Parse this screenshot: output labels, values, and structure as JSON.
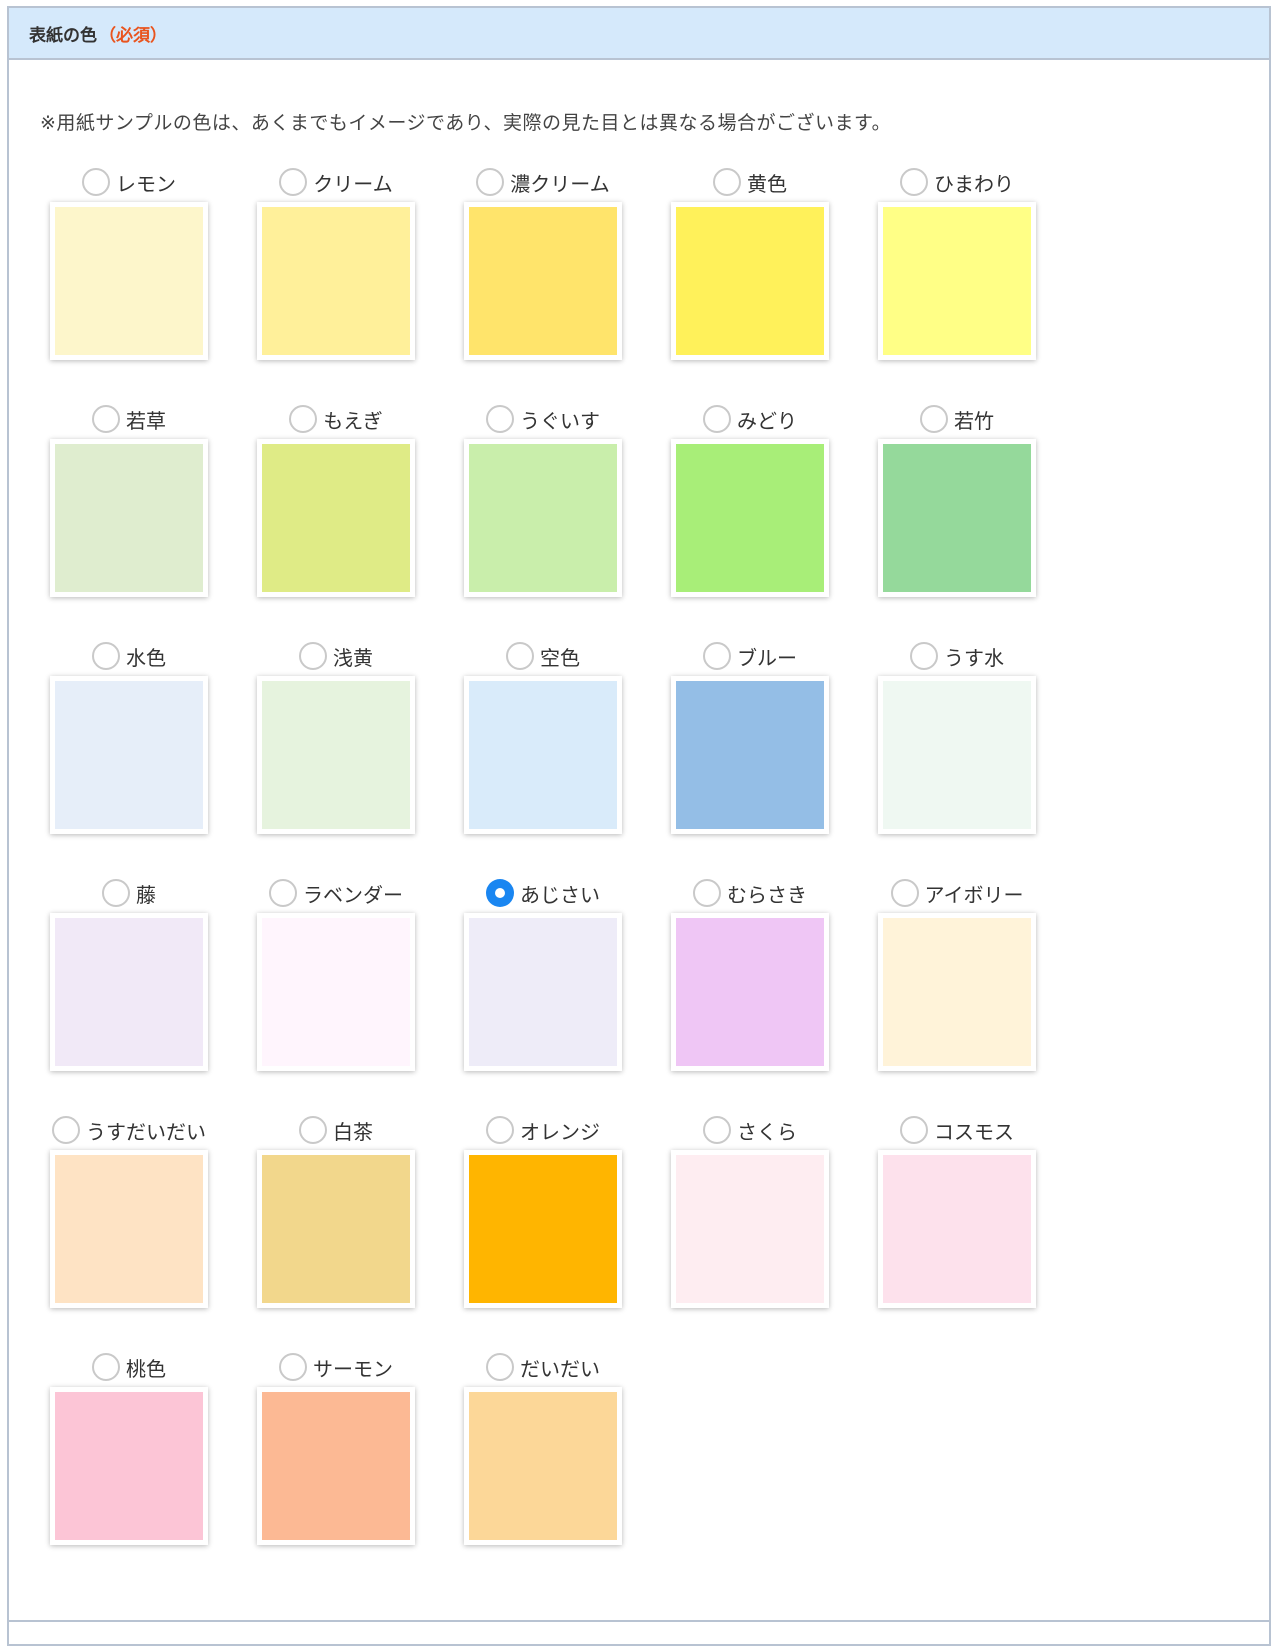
{
  "section": {
    "title": "表紙の色",
    "required": "（必須）",
    "note": "※用紙サンプルの色は、あくまでもイメージであり、実際の見た目とは異なる場合がございます。"
  },
  "selected": "あじさい",
  "colors": [
    {
      "name": "レモン",
      "hex": "#fdf6cb"
    },
    {
      "name": "クリーム",
      "hex": "#fff09a"
    },
    {
      "name": "濃クリーム",
      "hex": "#ffe46b"
    },
    {
      "name": "黄色",
      "hex": "#fff15a"
    },
    {
      "name": "ひまわり",
      "hex": "#ffff86"
    },
    {
      "name": "若草",
      "hex": "#dfedcf"
    },
    {
      "name": "もえぎ",
      "hex": "#dfeb86"
    },
    {
      "name": "うぐいす",
      "hex": "#c9eeab"
    },
    {
      "name": "みどり",
      "hex": "#a8ee78"
    },
    {
      "name": "若竹",
      "hex": "#95d99b"
    },
    {
      "name": "水色",
      "hex": "#e6eef9"
    },
    {
      "name": "浅黄",
      "hex": "#e6f3de"
    },
    {
      "name": "空色",
      "hex": "#d9ebfa"
    },
    {
      "name": "ブルー",
      "hex": "#94bee6"
    },
    {
      "name": "うす水",
      "hex": "#eff8f2"
    },
    {
      "name": "藤",
      "hex": "#f1e9f7"
    },
    {
      "name": "ラベンダー",
      "hex": "#fff5fd"
    },
    {
      "name": "あじさい",
      "hex": "#eeecf8"
    },
    {
      "name": "むらさき",
      "hex": "#efc6f5"
    },
    {
      "name": "アイボリー",
      "hex": "#fff3d9"
    },
    {
      "name": "うすだいだい",
      "hex": "#fee3c4"
    },
    {
      "name": "白茶",
      "hex": "#f2d78c"
    },
    {
      "name": "オレンジ",
      "hex": "#ffb500"
    },
    {
      "name": "さくら",
      "hex": "#feedf1"
    },
    {
      "name": "コスモス",
      "hex": "#fde1ec"
    },
    {
      "name": "桃色",
      "hex": "#fcc5d6"
    },
    {
      "name": "サーモン",
      "hex": "#fcb994"
    },
    {
      "name": "だいだい",
      "hex": "#fcd798"
    }
  ]
}
